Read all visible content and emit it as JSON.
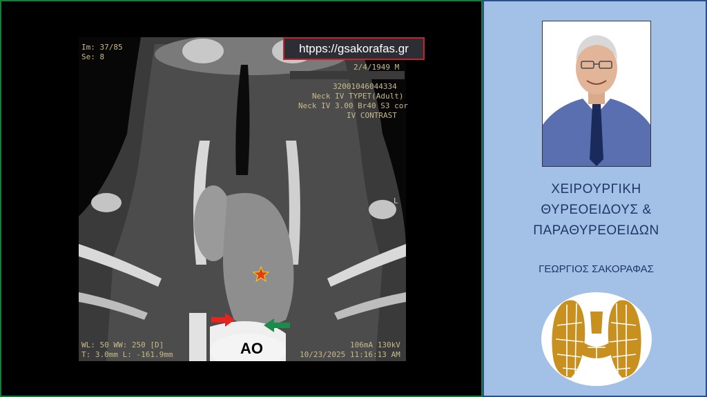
{
  "scan": {
    "im": "Im: 37/85",
    "se": "Se: 8",
    "dob": "2/4/1949 M",
    "study_id": "32001046044334",
    "protocol_line1": "Neck IV TYPET(Adult)",
    "protocol_line2": "Neck IV 3.00 Br40 S3 cor",
    "contrast": "IV CONTRAST",
    "side_marker": "L",
    "window": "WL: 50 WW: 250 [D]",
    "thickness": "T: 3.0mm L: -161.9mm",
    "tube": "106mA 130kV",
    "datetime": "10/23/2025 11:16:13 AM",
    "ao_label": "AO"
  },
  "website": "htpps://gsakorafas.gr",
  "sidebar": {
    "title_line1": "ΧΕΙΡΟΥΡΓΙΚΗ",
    "title_line2": "ΘΥΡΕΟΕΙΔΟΥΣ &",
    "title_line3": "ΠΑΡΑΘΥΡΕΟΕΙΔΩΝ",
    "author": "ΓΕΩΡΓΙΟΣ ΣΑΚΟΡΑΦΑΣ"
  },
  "colors": {
    "left_border": "#1a7a3a",
    "right_bg": "#a3c0e6",
    "title_text": "#1f3668",
    "url_border": "#c0262b",
    "red_arrow": "#e8221c",
    "green_arrow": "#1b8a4a",
    "star": "#e23a1a",
    "thyroid_gold": "#c8901e"
  }
}
